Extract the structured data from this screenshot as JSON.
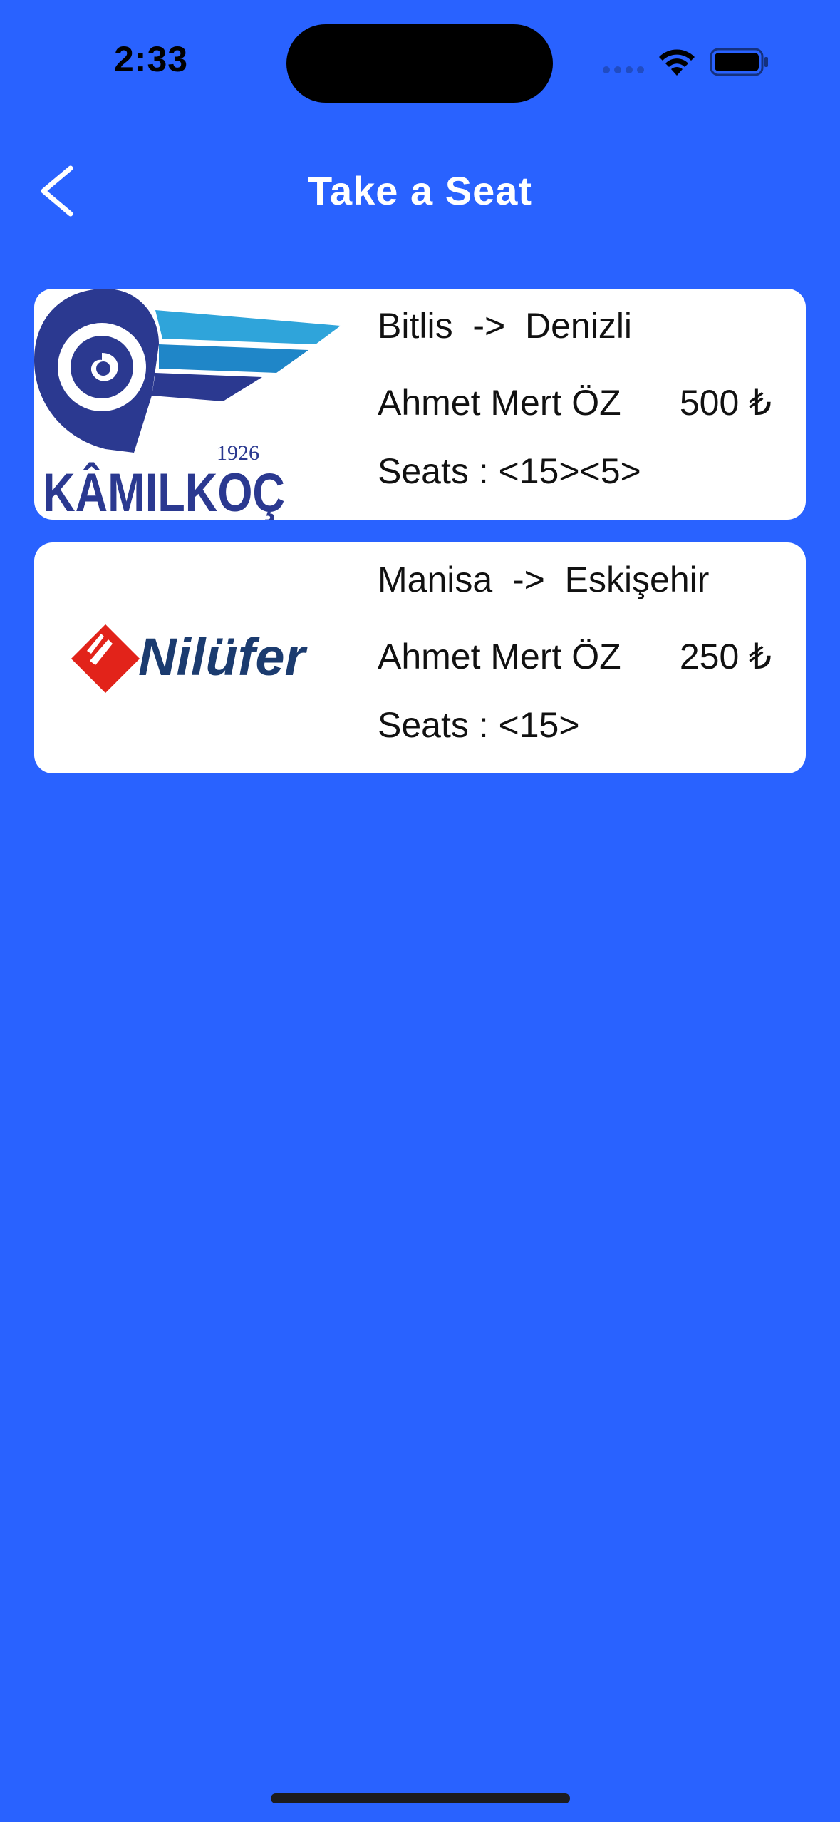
{
  "status_bar": {
    "time": "2:33"
  },
  "header": {
    "title": "Take a Seat",
    "back_icon": "chevron-left-icon"
  },
  "trips": [
    {
      "company_logo": "kamil-koc-logo",
      "logo_text": "KÂMILKOÇ",
      "logo_year": "1926",
      "route": "Bitlis  ->  Denizli",
      "driver": "Ahmet Mert ÖZ",
      "price": "500 ₺",
      "seats": "Seats : <15><5>"
    },
    {
      "company_logo": "nilufer-logo",
      "logo_text": "Nilüfer",
      "route": "Manisa  ->  Eskişehir",
      "driver": "Ahmet Mert ÖZ",
      "price": "250 ₺",
      "seats": "Seats : <15>"
    }
  ],
  "colors": {
    "background": "#2962FF",
    "card": "#FFFFFF",
    "kamilkoc_navy": "#2B3990",
    "kamilkoc_cyan": "#00A9E0",
    "nilufer_red": "#E2231A",
    "nilufer_navy": "#1B3B6F"
  }
}
